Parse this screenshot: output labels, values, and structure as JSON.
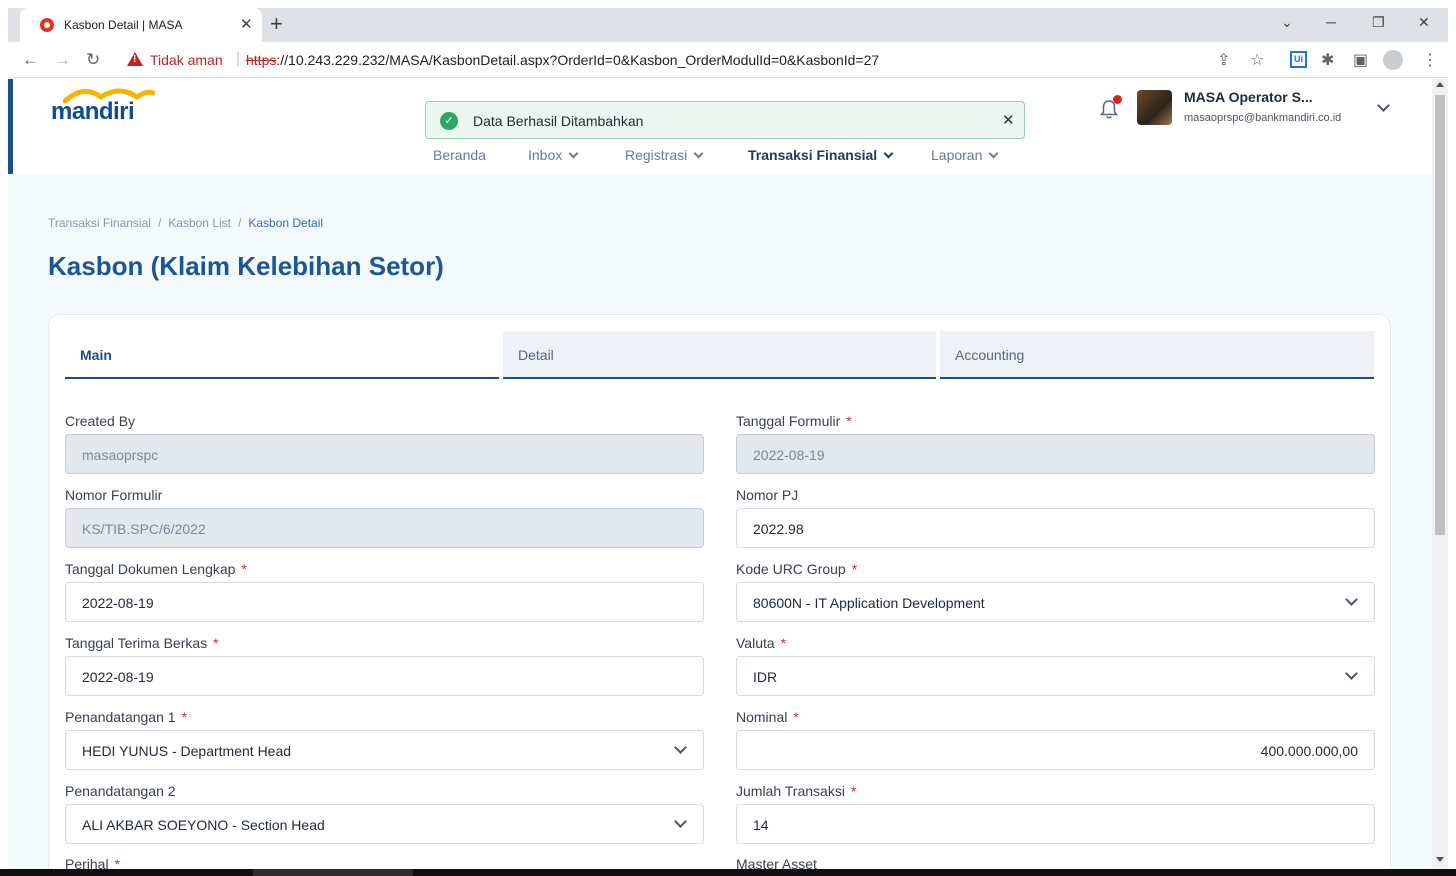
{
  "browser": {
    "tab_title": "Kasbon Detail | MASA",
    "tab_close": "✕",
    "new_tab": "+",
    "minimize": "─",
    "restore": "❐",
    "close": "✕",
    "insecure_label": "Tidak aman",
    "url_protocol": "https",
    "url_rest": "://10.243.229.232/MASA/KasbonDetail.aspx?OrderId=0&Kasbon_OrderModulId=0&KasbonId=27",
    "ui_ext": "Ui"
  },
  "header": {
    "logo": "mandiri",
    "toast_text": "Data Berhasil Ditambahkan",
    "toast_close": "✕",
    "nav": [
      "Beranda",
      "Inbox",
      "Registrasi",
      "Transaksi Finansial",
      "Laporan"
    ],
    "user_name": "MASA Operator S...",
    "user_email": "masaoprspc@bankmandiri.co.id"
  },
  "breadcrumb": [
    "Transaksi Finansial",
    "Kasbon List",
    "Kasbon Detail"
  ],
  "page_title": "Kasbon (Klaim Kelebihan Setor)",
  "tabs": [
    "Main",
    "Detail",
    "Accounting"
  ],
  "form": {
    "created_by": {
      "label": "Created By",
      "value": "masaoprspc"
    },
    "tanggal_formulir": {
      "label": "Tanggal Formulir",
      "value": "2022-08-19"
    },
    "nomor_formulir": {
      "label": "Nomor Formulir",
      "value": "KS/TIB.SPC/6/2022"
    },
    "nomor_pj": {
      "label": "Nomor PJ",
      "value": "2022.98"
    },
    "tgl_dokumen": {
      "label": "Tanggal Dokumen Lengkap",
      "value": "2022-08-19"
    },
    "kode_urc": {
      "label": "Kode URC Group",
      "value": "80600N - IT Application Development"
    },
    "tgl_terima": {
      "label": "Tanggal Terima Berkas",
      "value": "2022-08-19"
    },
    "valuta": {
      "label": "Valuta",
      "value": "IDR"
    },
    "penandatangan1": {
      "label": "Penandatangan 1",
      "value": "HEDI YUNUS - Department Head"
    },
    "nominal": {
      "label": "Nominal",
      "value": "400.000.000,00"
    },
    "penandatangan2": {
      "label": "Penandatangan 2",
      "value": "ALI AKBAR SOEYONO - Section Head"
    },
    "jumlah_transaksi": {
      "label": "Jumlah Transaksi",
      "value": "14"
    },
    "perihal": {
      "label": "Perihal"
    },
    "master_asset": {
      "label": "Master Asset"
    },
    "required_mark": "*"
  },
  "colors": {
    "brand": "#1b4f8a",
    "title": "#1b5796",
    "toast_bg": "#eaf6ef",
    "required": "#d62828"
  }
}
